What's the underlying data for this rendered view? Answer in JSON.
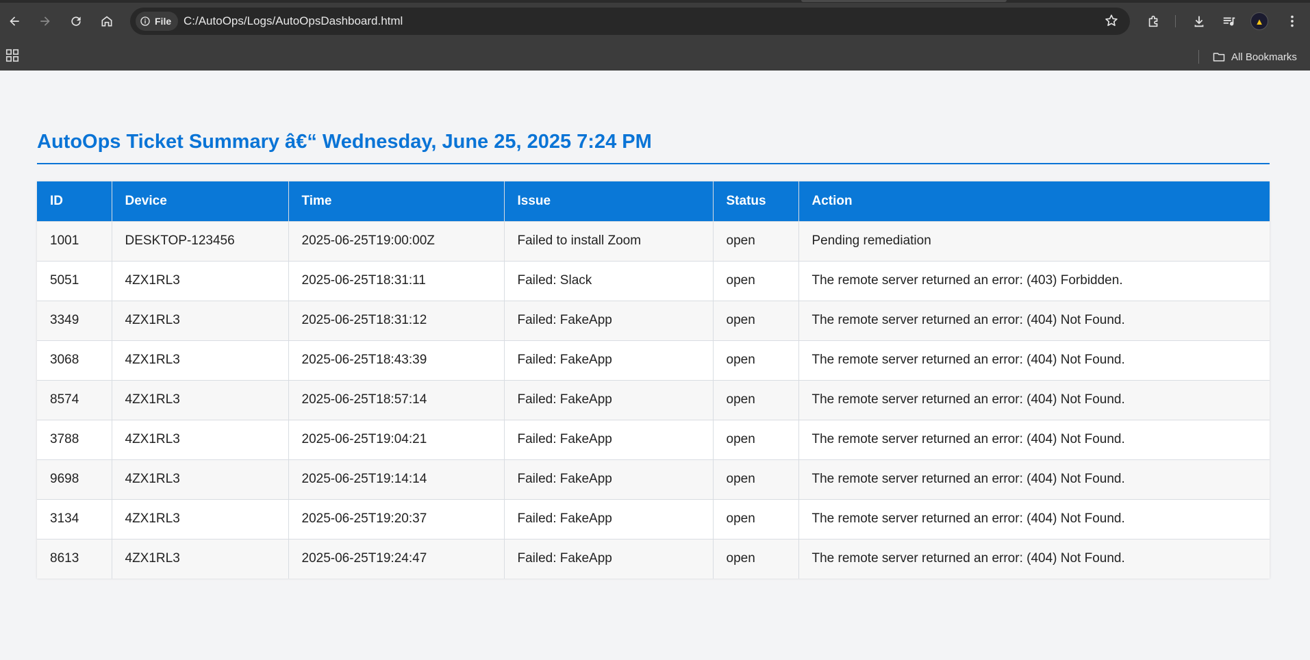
{
  "browser": {
    "site_chip_label": "File",
    "url": "C:/AutoOps/Logs/AutoOpsDashboard.html",
    "bookmarks_label": "All Bookmarks"
  },
  "page": {
    "title": "AutoOps Ticket Summary â€“ Wednesday, June 25, 2025 7:24 PM",
    "accent_color": "#0a78d7"
  },
  "table": {
    "headers": [
      "ID",
      "Device",
      "Time",
      "Issue",
      "Status",
      "Action"
    ],
    "rows": [
      [
        "1001",
        "DESKTOP-123456",
        "2025-06-25T19:00:00Z",
        "Failed to install Zoom",
        "open",
        "Pending remediation"
      ],
      [
        "5051",
        "4ZX1RL3",
        "2025-06-25T18:31:11",
        "Failed: Slack",
        "open",
        "The remote server returned an error: (403) Forbidden."
      ],
      [
        "3349",
        "4ZX1RL3",
        "2025-06-25T18:31:12",
        "Failed: FakeApp",
        "open",
        "The remote server returned an error: (404) Not Found."
      ],
      [
        "3068",
        "4ZX1RL3",
        "2025-06-25T18:43:39",
        "Failed: FakeApp",
        "open",
        "The remote server returned an error: (404) Not Found."
      ],
      [
        "8574",
        "4ZX1RL3",
        "2025-06-25T18:57:14",
        "Failed: FakeApp",
        "open",
        "The remote server returned an error: (404) Not Found."
      ],
      [
        "3788",
        "4ZX1RL3",
        "2025-06-25T19:04:21",
        "Failed: FakeApp",
        "open",
        "The remote server returned an error: (404) Not Found."
      ],
      [
        "9698",
        "4ZX1RL3",
        "2025-06-25T19:14:14",
        "Failed: FakeApp",
        "open",
        "The remote server returned an error: (404) Not Found."
      ],
      [
        "3134",
        "4ZX1RL3",
        "2025-06-25T19:20:37",
        "Failed: FakeApp",
        "open",
        "The remote server returned an error: (404) Not Found."
      ],
      [
        "8613",
        "4ZX1RL3",
        "2025-06-25T19:24:47",
        "Failed: FakeApp",
        "open",
        "The remote server returned an error: (404) Not Found."
      ]
    ]
  }
}
